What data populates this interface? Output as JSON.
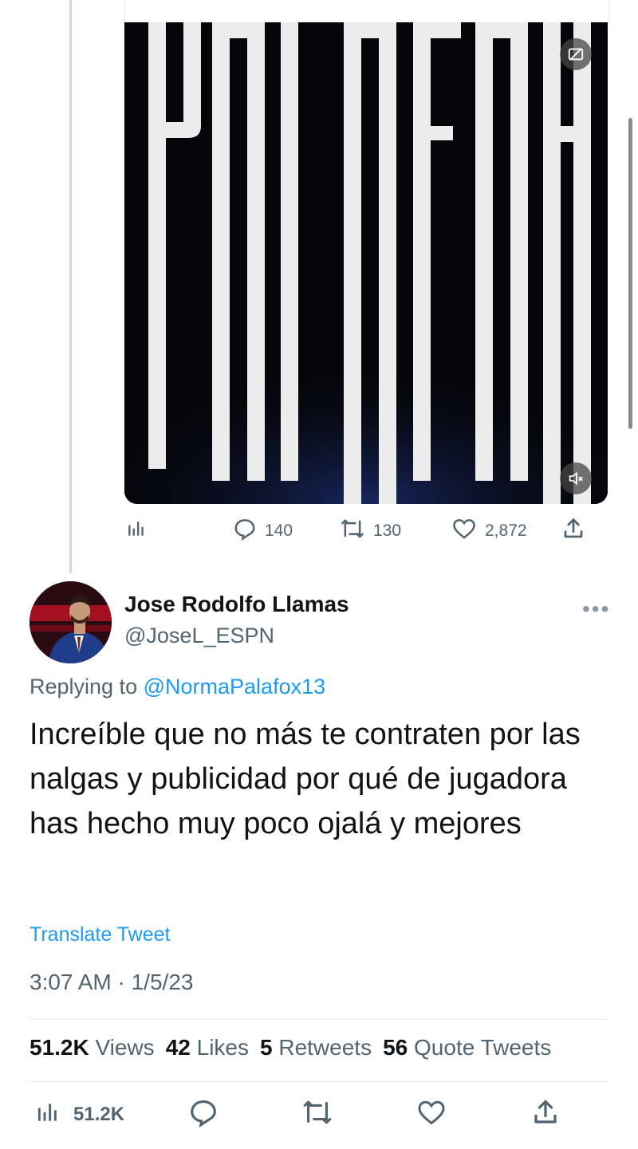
{
  "media": {
    "watermark_text": "PALAFOX",
    "captions_icon": "captions-icon",
    "mute_icon": "mute-icon"
  },
  "previous_tweet": {
    "views_icon": "analytics-icon",
    "replies": "140",
    "retweets": "130",
    "likes": "2,872",
    "share_icon": "share-icon"
  },
  "tweet": {
    "author_name": "Jose Rodolfo Llamas",
    "author_handle": "@JoseL_ESPN",
    "more_label": "•••",
    "replying_prefix": "Replying to",
    "replying_mention": "@NormaPalafox13",
    "text": "Increíble que no más te contraten por las nalgas y publicidad por qué de jugadora has hecho muy poco ojalá y mejores",
    "translate_label": "Translate Tweet",
    "timestamp": "3:07 AM · 1/5/23"
  },
  "stats": {
    "views_count": "51.2K",
    "views_label": "Views",
    "likes_count": "42",
    "likes_label": "Likes",
    "retweets_count": "5",
    "retweets_label": "Retweets",
    "quotes_count": "56",
    "quotes_label": "Quote Tweets"
  },
  "bottom_bar": {
    "views_count": "51.2K"
  },
  "colors": {
    "link": "#1d9bf0",
    "secondary_text": "#536471",
    "primary_text": "#0f1419"
  }
}
